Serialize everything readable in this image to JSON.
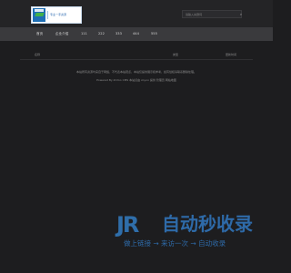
{
  "header": {
    "logo_text": "专业一手资源",
    "search_placeholder": "请输入关键词",
    "search_button": "⌕"
  },
  "nav": {
    "items": [
      "首页",
      "企业介绍",
      "111",
      "222",
      "333",
      "444",
      "555"
    ]
  },
  "content": {
    "crumb_left": "名称",
    "crumb_middle": "类型",
    "crumb_right": "更新时间"
  },
  "footer": {
    "notice": "本站所有资源均来自于网络，不代表本站观点，本站仅提供展示和参考，如有侵权请联系删除处理。",
    "powered": "Powered By ZoYoo CMS  本站点由 zoyoo 提供 管理员 网站地图"
  },
  "watermark": {
    "logo": "JR",
    "title": "自动秒收录",
    "slogan": "做上链接 → 来访一次 → 自动收录"
  }
}
